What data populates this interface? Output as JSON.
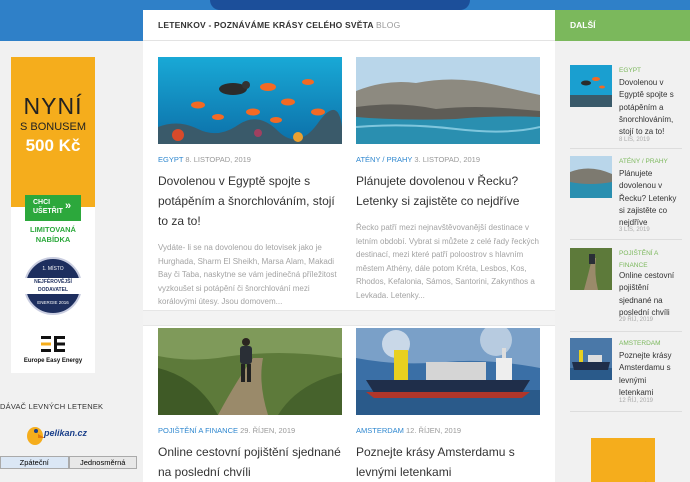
{
  "left": {
    "ad": {
      "headline": "NYNÍ",
      "bonus": "S BONUSEM",
      "amount": "500 Kč",
      "cta": "CHCI UŠETŘIT",
      "cta_arrow": "»",
      "limited": "LIMITOVANÁ NABÍDKA",
      "badge_top": "1. MÍSTO",
      "badge_main": "NEJFÉROVĚJŠÍ DODAVATEL",
      "badge_bottom": "ENERGIE 2016",
      "brand": "Europe Easy Energy",
      "colors": {
        "orange": "#f5ad1c",
        "green": "#2ca83c",
        "navy": "#1d2e5e"
      }
    },
    "widget_title": "DÁVAČ LEVNÝCH LETENEK",
    "logo_text": "pelikan.cz",
    "tabs": [
      {
        "label": "Zpáteční",
        "active": true
      },
      {
        "label": "Jednosměrná",
        "active": false
      }
    ],
    "footer_fragment": "z"
  },
  "main": {
    "header_title": "LETENKOV - POZNÁVÁME KRÁSY CELÉHO SVĚTA",
    "header_blog": "BLOG",
    "posts": [
      {
        "image": "underwater-fish-reef",
        "categories": [
          "EGYPT"
        ],
        "date": "8. LISTOPAD, 2019",
        "title": "Dovolenou v Egyptě spojte s potápěním a šnorchlováním, stojí to za to!",
        "excerpt": "Vydáte- li se na dovolenou do letovisek jako je Hurghada, Sharm El Sheikh, Marsa Alam, Makadi Bay či Taba, naskytne se vám jedinečná příležitost vyzkoušet si potápění či šnorchlování mezi korálovými útesy. Jsou domovem..."
      },
      {
        "image": "coastal-cliffs-sea",
        "categories": [
          "ATÉNY",
          "PRAHY"
        ],
        "date": "3. LISTOPAD, 2019",
        "title": "Plánujete dovolenou v Řecku? Letenky si zajistěte co nejdříve",
        "excerpt": "Řecko patří mezi nejnavštěvovanější destinace v letním období. Vybrat si můžete z celé řady řeckých destinací, mezi které patří poloostrov s hlavním městem Athény, dále potom Kréta, Lesbos, Kos, Rhodos, Kefalonia, Sámos, Santorini, Zakynthos a Levkada. Letenky..."
      },
      {
        "image": "hiker-on-trail",
        "categories": [
          "POJIŠTĚNÍ A FINANCE"
        ],
        "date": "29. ŘÍJEN, 2019",
        "title": "Online cestovní pojištění sjednané na poslední chvíli",
        "excerpt": ""
      },
      {
        "image": "cargo-ship-harbor",
        "categories": [
          "AMSTERDAM"
        ],
        "date": "12. ŘÍJEN, 2019",
        "title": "Poznejte krásy Amsterdamu s levnými letenkami",
        "excerpt": ""
      }
    ]
  },
  "right": {
    "header": "DALŠÍ",
    "items": [
      {
        "category": "EGYPT",
        "title": "Dovolenou v Egyptě spojte s potápěním a šnorchlováním, stojí to za to!",
        "date": "8 LIS, 2019"
      },
      {
        "category": "ATÉNY / PRAHY",
        "title": "Plánujete dovolenou v Řecku? Letenky si zajistěte co nejdříve",
        "date": "3 LIS, 2019"
      },
      {
        "category": "POJIŠTĚNÍ A FINANCE",
        "title": "Online cestovní pojištění sjednané na poslední chvíli",
        "date": "29 ŘÍJ, 2019"
      },
      {
        "category": "AMSTERDAM",
        "title": "Poznejte krásy Amsterdamu s levnými letenkami",
        "date": "12 ŘÍJ, 2019"
      }
    ]
  },
  "colors": {
    "header_blue": "#2f80c8",
    "sidebar_green": "#7bb85c",
    "category_blue": "#2e87cf"
  }
}
